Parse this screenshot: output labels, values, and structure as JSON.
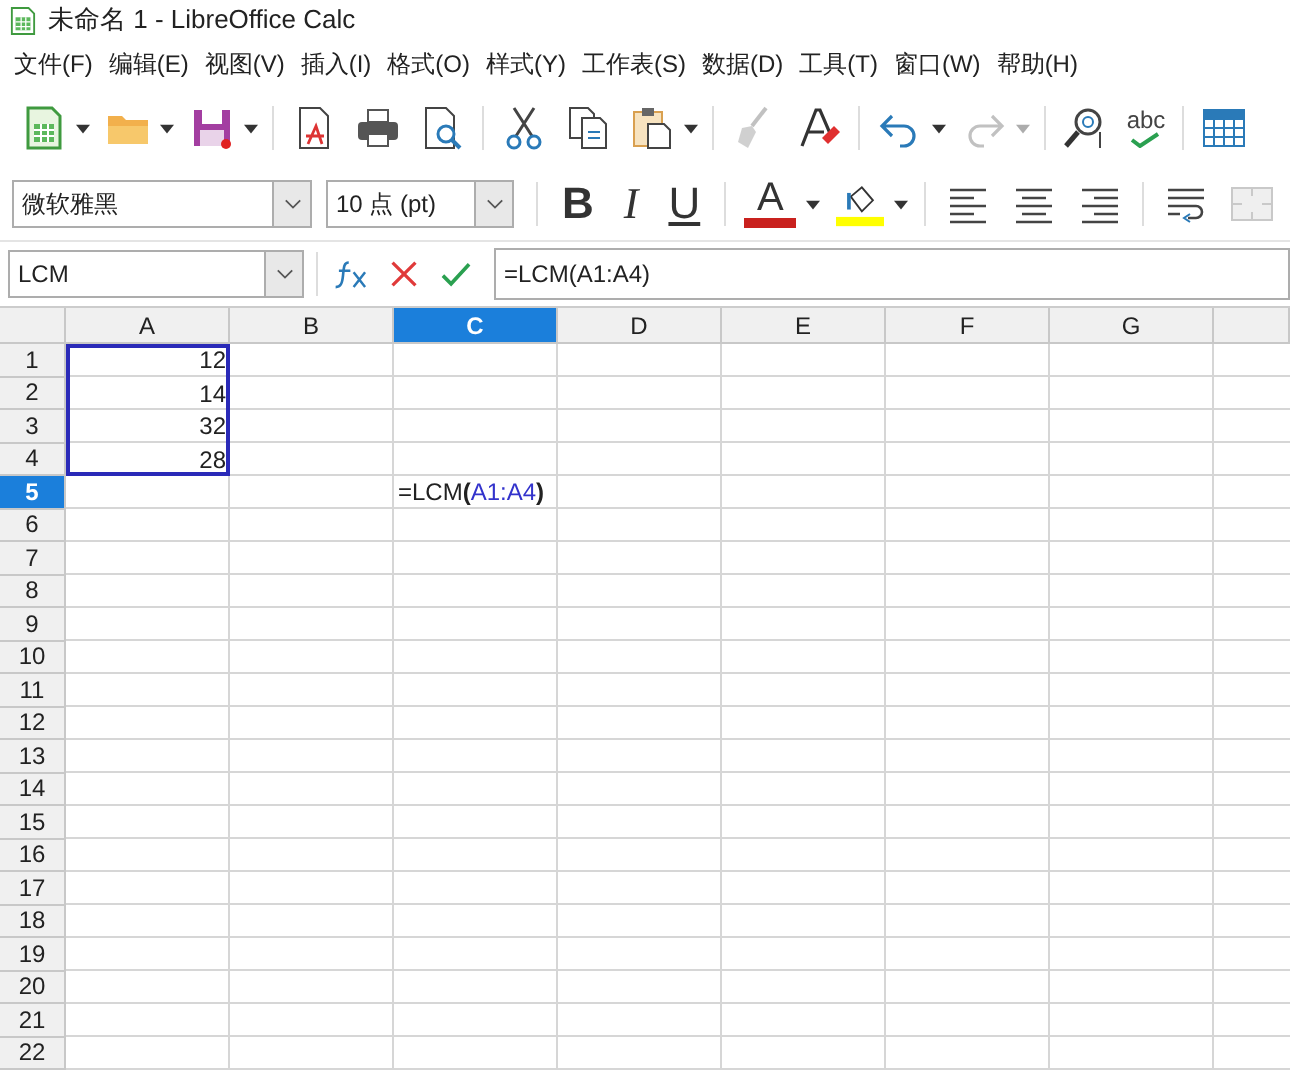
{
  "window": {
    "title": "未命名 1 - LibreOffice Calc"
  },
  "menu": [
    "文件(F)",
    "编辑(E)",
    "视图(V)",
    "插入(I)",
    "格式(O)",
    "样式(Y)",
    "工作表(S)",
    "数据(D)",
    "工具(T)",
    "窗口(W)",
    "帮助(H)"
  ],
  "standard_toolbar": [
    {
      "kind": "new-spreadsheet",
      "dropdown": true,
      "disabled": false
    },
    {
      "kind": "open",
      "dropdown": true,
      "disabled": false
    },
    {
      "kind": "save",
      "dropdown": true,
      "disabled": false
    },
    {
      "kind": "separator"
    },
    {
      "kind": "export-pdf",
      "disabled": false
    },
    {
      "kind": "print",
      "disabled": false
    },
    {
      "kind": "print-preview",
      "disabled": false
    },
    {
      "kind": "separator"
    },
    {
      "kind": "cut",
      "disabled": false
    },
    {
      "kind": "copy",
      "disabled": false
    },
    {
      "kind": "paste",
      "dropdown": true,
      "disabled": false
    },
    {
      "kind": "separator"
    },
    {
      "kind": "clone-formatting",
      "disabled": true
    },
    {
      "kind": "clear-formatting",
      "disabled": false
    },
    {
      "kind": "separator"
    },
    {
      "kind": "undo",
      "dropdown": true,
      "disabled": false
    },
    {
      "kind": "redo",
      "dropdown": true,
      "disabled": true
    },
    {
      "kind": "separator"
    },
    {
      "kind": "find-replace",
      "disabled": false
    },
    {
      "kind": "spellcheck",
      "glyph": "abc",
      "disabled": false
    },
    {
      "kind": "separator"
    },
    {
      "kind": "table-grid",
      "disabled": false
    }
  ],
  "formatting_toolbar": {
    "font_name": "微软雅黑",
    "font_size": "10 点 (pt)",
    "buttons": [
      {
        "kind": "separator"
      },
      {
        "kind": "bold",
        "glyph": "B",
        "disabled": false
      },
      {
        "kind": "italic",
        "glyph": "I",
        "disabled": false
      },
      {
        "kind": "underline",
        "glyph": "U",
        "disabled": false
      },
      {
        "kind": "separator"
      },
      {
        "kind": "font-color",
        "glyph": "A",
        "color": "#c9211e",
        "dropdown": true,
        "disabled": false
      },
      {
        "kind": "highlight",
        "color": "#ffff00",
        "dropdown": true,
        "disabled": false
      },
      {
        "kind": "separator"
      },
      {
        "kind": "align-left",
        "disabled": false
      },
      {
        "kind": "align-center",
        "disabled": false
      },
      {
        "kind": "align-right",
        "disabled": false
      },
      {
        "kind": "separator"
      },
      {
        "kind": "wrap-text",
        "disabled": false
      },
      {
        "kind": "merge-cells",
        "disabled": true
      }
    ]
  },
  "formula_bar": {
    "name_box": "LCM",
    "formula": "=LCM(A1:A4)"
  },
  "sheet": {
    "columns": [
      {
        "label": "A",
        "selected": false
      },
      {
        "label": "B",
        "selected": false
      },
      {
        "label": "C",
        "selected": true
      },
      {
        "label": "D",
        "selected": false
      },
      {
        "label": "E",
        "selected": false
      },
      {
        "label": "F",
        "selected": false
      },
      {
        "label": "G",
        "selected": false
      }
    ],
    "rows": [
      {
        "label": "1",
        "selected": false,
        "cells": {
          "A": {
            "value": "12",
            "selected": true
          }
        }
      },
      {
        "label": "2",
        "selected": false,
        "cells": {
          "A": {
            "value": "14",
            "selected": true
          }
        }
      },
      {
        "label": "3",
        "selected": false,
        "cells": {
          "A": {
            "value": "32",
            "selected": true
          }
        }
      },
      {
        "label": "4",
        "selected": false,
        "cells": {
          "A": {
            "value": "28",
            "selected": true
          }
        }
      },
      {
        "label": "5",
        "selected": true,
        "cells": {
          "C": {
            "selected": false,
            "parts": [
              {
                "kind": "plain",
                "text": "=LCM"
              },
              {
                "kind": "paren",
                "text": "("
              },
              {
                "kind": "reference",
                "text": "A1:A4",
                "color": "#3333cc"
              },
              {
                "kind": "paren",
                "text": ")"
              }
            ]
          }
        }
      },
      {
        "label": "6",
        "selected": false
      },
      {
        "label": "7",
        "selected": false
      },
      {
        "label": "8",
        "selected": false
      },
      {
        "label": "9",
        "selected": false
      },
      {
        "label": "10",
        "selected": false
      },
      {
        "label": "11",
        "selected": false
      },
      {
        "label": "12",
        "selected": false
      },
      {
        "label": "13",
        "selected": false
      },
      {
        "label": "14",
        "selected": false
      },
      {
        "label": "15",
        "selected": false
      },
      {
        "label": "16",
        "selected": false
      },
      {
        "label": "17",
        "selected": false
      },
      {
        "label": "18",
        "selected": false
      },
      {
        "label": "19",
        "selected": false
      },
      {
        "label": "20",
        "selected": false
      },
      {
        "label": "21",
        "selected": false
      },
      {
        "label": "22",
        "selected": false
      }
    ]
  }
}
